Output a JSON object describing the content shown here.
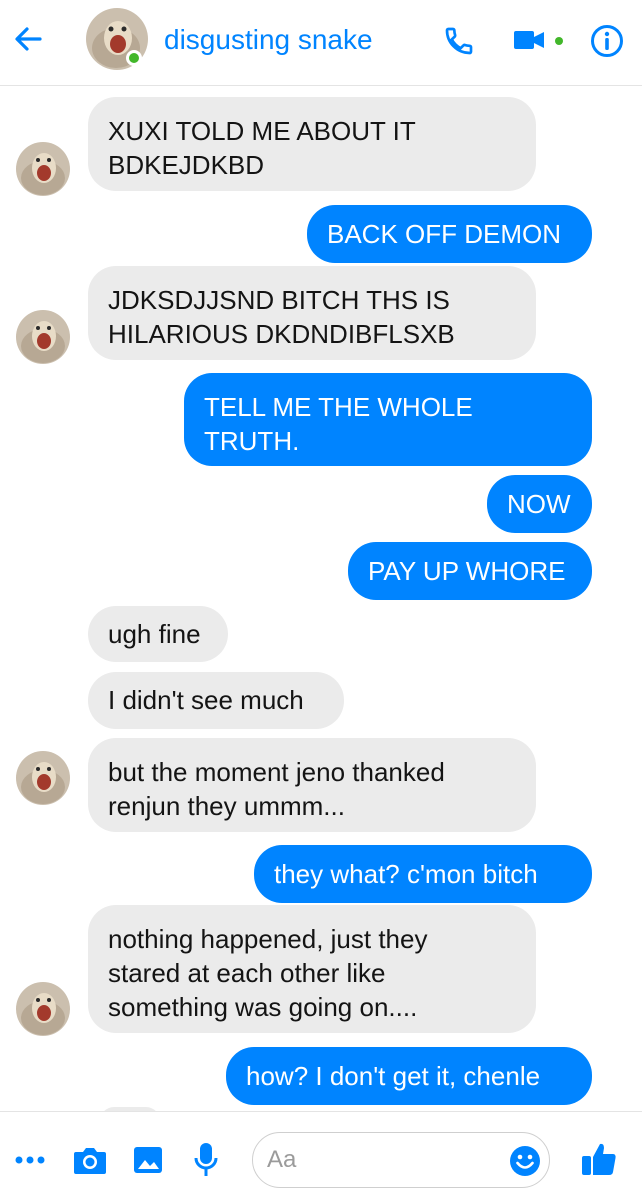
{
  "header": {
    "contact_name": "disgusting snake",
    "icons": [
      "back-arrow-icon",
      "phone-icon",
      "video-camera-icon",
      "info-icon"
    ]
  },
  "messages": [
    {
      "from": "them",
      "text": "XUXI TOLD ME ABOUT IT\nBDKEJDKBD"
    },
    {
      "from": "me",
      "text": "BACK OFF DEMON"
    },
    {
      "from": "them",
      "text": "JDKSDJJSND BITCH THS IS\nHILARIOUS DKDNDIBFLSXB"
    },
    {
      "from": "me",
      "text": "TELL ME THE WHOLE\nTRUTH."
    },
    {
      "from": "me",
      "text": "NOW"
    },
    {
      "from": "me",
      "text": "PAY UP WHORE"
    },
    {
      "from": "them",
      "text": "ugh fine"
    },
    {
      "from": "them",
      "text": "I didn't see much"
    },
    {
      "from": "them",
      "text": "but the moment jeno thanked\nrenjun they ummm..."
    },
    {
      "from": "me",
      "text": "they what? c'mon bitch"
    },
    {
      "from": "them",
      "text": "nothing happened, just they\nstared at each other like\nsomething was going on...."
    },
    {
      "from": "me",
      "text": "how? I don't get it, chenle"
    }
  ],
  "composer": {
    "placeholder": "Aa",
    "icons": [
      "more-icon",
      "camera-icon",
      "image-icon",
      "microphone-icon",
      "emoji-icon",
      "thumbs-up-icon"
    ]
  },
  "colors": {
    "accent": "#0084ff",
    "incoming_bubble": "#ebebeb",
    "online": "#42b72a"
  }
}
